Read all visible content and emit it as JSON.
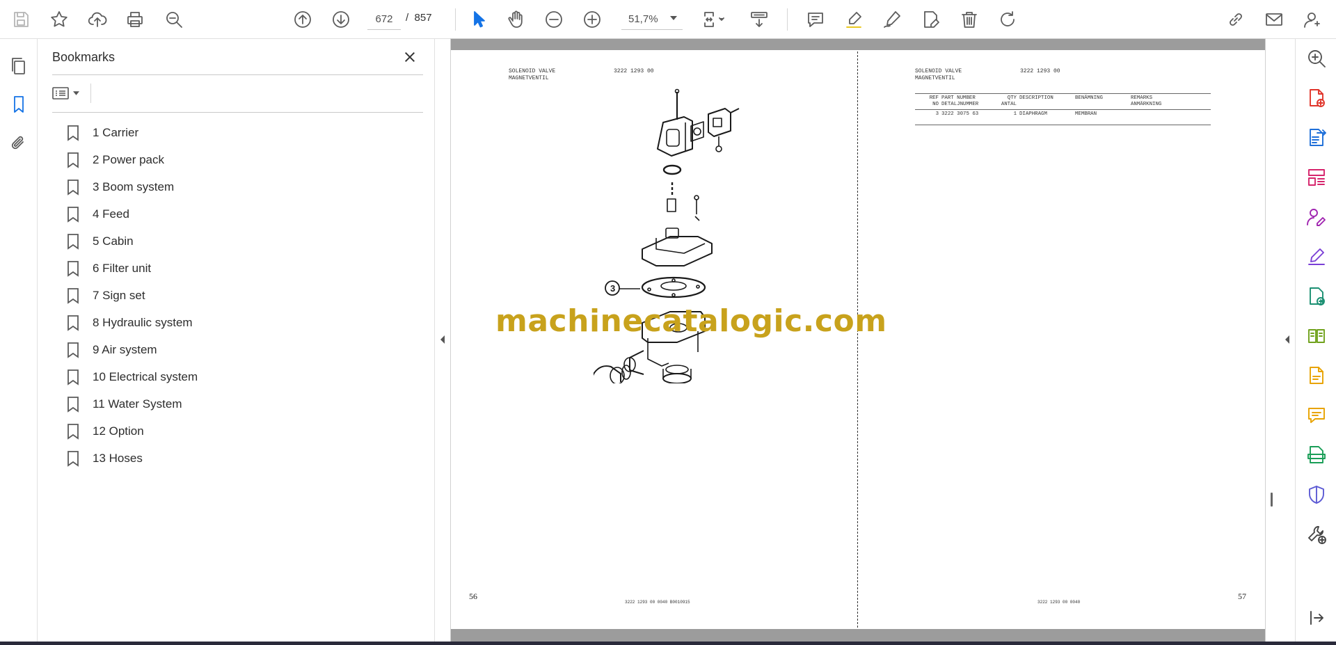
{
  "toolbar": {
    "current_page": "672",
    "page_separator": "/",
    "total_pages": "857",
    "zoom": "51,7%"
  },
  "bookmarks": {
    "title": "Bookmarks",
    "items": [
      {
        "label": "1 Carrier"
      },
      {
        "label": "2 Power pack"
      },
      {
        "label": "3 Boom system"
      },
      {
        "label": "4 Feed"
      },
      {
        "label": "5 Cabin"
      },
      {
        "label": "6 Filter unit"
      },
      {
        "label": "7 Sign set"
      },
      {
        "label": "8 Hydraulic system"
      },
      {
        "label": "9 Air system"
      },
      {
        "label": "10 Electrical system"
      },
      {
        "label": "11 Water System"
      },
      {
        "label": "12 Option"
      },
      {
        "label": "13 Hoses"
      }
    ]
  },
  "document": {
    "left_page": {
      "header_title": "SOLENOID VALVE\nMAGNETVENTIL",
      "header_code": "3222 1293 00",
      "callout": "3",
      "page_number": "56",
      "footer_code": "3222 1293 00  0040  B0010915"
    },
    "right_page": {
      "header_title": "SOLENOID VALVE\nMAGNETVENTIL",
      "header_code": "3222 1293 00",
      "table": {
        "headers": [
          {
            "l1": "REF",
            "l2": "NO"
          },
          {
            "l1": "PART NUMBER",
            "l2": "DETALJNUMMER"
          },
          {
            "l1": "QTY",
            "l2": "ANTAL"
          },
          {
            "l1": "DESCRIPTION",
            "l2": ""
          },
          {
            "l1": "BENÄMNING",
            "l2": ""
          },
          {
            "l1": "REMARKS",
            "l2": "ANMÄRKNING"
          }
        ],
        "rows": [
          {
            "ref": "3",
            "part": "3222 3075 63",
            "qty": "1",
            "desc": "DIAPHRAGM",
            "ben": "MEMBRAN",
            "rem": ""
          }
        ]
      },
      "page_number": "57",
      "footer_code": "3222 1293 00  0040"
    },
    "watermark": "machinecatalogic.com"
  },
  "colors": {
    "accent_blue": "#1473e6",
    "watermark_gold": "#c8a21c"
  }
}
